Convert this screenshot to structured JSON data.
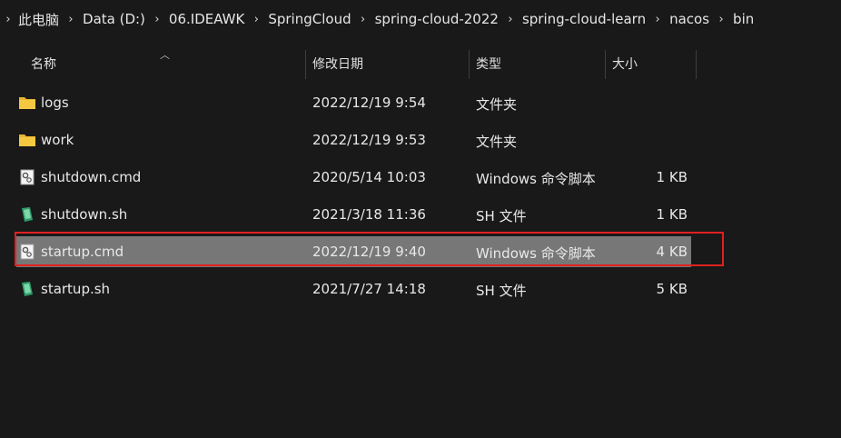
{
  "breadcrumb": {
    "items": [
      "此电脑",
      "Data (D:)",
      "06.IDEAWK",
      "SpringCloud",
      "spring-cloud-2022",
      "spring-cloud-learn",
      "nacos",
      "bin"
    ]
  },
  "columns": {
    "name": "名称",
    "modified": "修改日期",
    "type": "类型",
    "size": "大小"
  },
  "files": [
    {
      "name": "logs",
      "modified": "2022/12/19 9:54",
      "type": "文件夹",
      "size": "",
      "icon": "folder-icon"
    },
    {
      "name": "work",
      "modified": "2022/12/19 9:53",
      "type": "文件夹",
      "size": "",
      "icon": "folder-icon"
    },
    {
      "name": "shutdown.cmd",
      "modified": "2020/5/14 10:03",
      "type": "Windows 命令脚本",
      "size": "1 KB",
      "icon": "cmd-script-icon"
    },
    {
      "name": "shutdown.sh",
      "modified": "2021/3/18 11:36",
      "type": "SH 文件",
      "size": "1 KB",
      "icon": "sh-file-icon"
    },
    {
      "name": "startup.cmd",
      "modified": "2022/12/19 9:40",
      "type": "Windows 命令脚本",
      "size": "4 KB",
      "icon": "cmd-script-icon",
      "selected": true
    },
    {
      "name": "startup.sh",
      "modified": "2021/7/27 14:18",
      "type": "SH 文件",
      "size": "5 KB",
      "icon": "sh-file-icon"
    }
  ],
  "colors": {
    "background": "#191919",
    "selection": "#777777",
    "highlight_border": "#e02020",
    "folder": "#f0c040"
  }
}
